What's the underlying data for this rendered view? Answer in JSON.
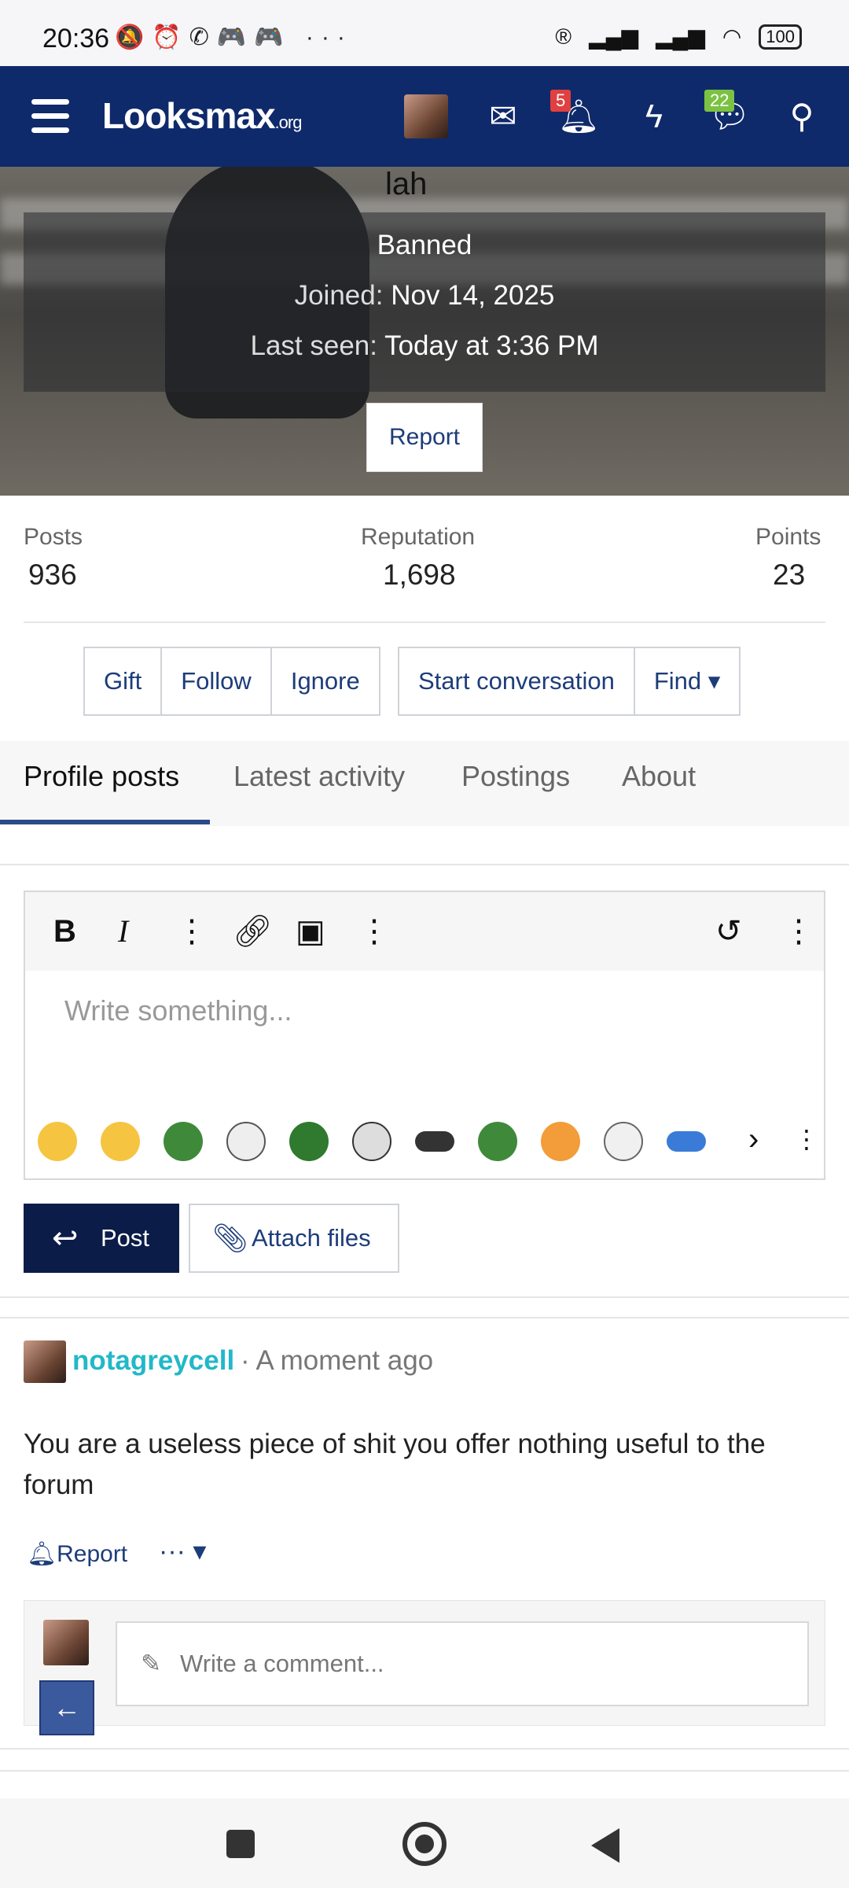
{
  "status_bar": {
    "time": "20:36",
    "icons": "🔕⏰✆🎮🎮 ···",
    "battery": "100"
  },
  "nav": {
    "logo": "Looksmax",
    "logo_suffix": ".org",
    "alerts_badge": "5",
    "conversations_badge": "22"
  },
  "profile": {
    "name_fragment": "lah",
    "status": "Banned",
    "joined_label": "Joined:",
    "joined_value": "Nov 14, 2025",
    "last_seen_label": "Last seen:",
    "last_seen_value": "Today at 3:36 PM",
    "report": "Report"
  },
  "stats": [
    {
      "label": "Posts",
      "value": "936"
    },
    {
      "label": "Reputation",
      "value": "1,698"
    },
    {
      "label": "Points",
      "value": "23"
    }
  ],
  "actions": {
    "gift": "Gift",
    "follow": "Follow",
    "ignore": "Ignore",
    "start_conversation": "Start conversation",
    "find": "Find ▾"
  },
  "tabs": [
    "Profile posts",
    "Latest activity",
    "Postings",
    "About"
  ],
  "editor": {
    "placeholder": "Write something...",
    "post": "Post",
    "attach": "Attach files"
  },
  "profile_post": {
    "username": "notagreycell",
    "time": "· A moment ago",
    "body": "You are a useless piece of shit you offer nothing useful to the forum",
    "report": "Report",
    "more": "··· ▾",
    "comment_placeholder": "Write a comment..."
  }
}
